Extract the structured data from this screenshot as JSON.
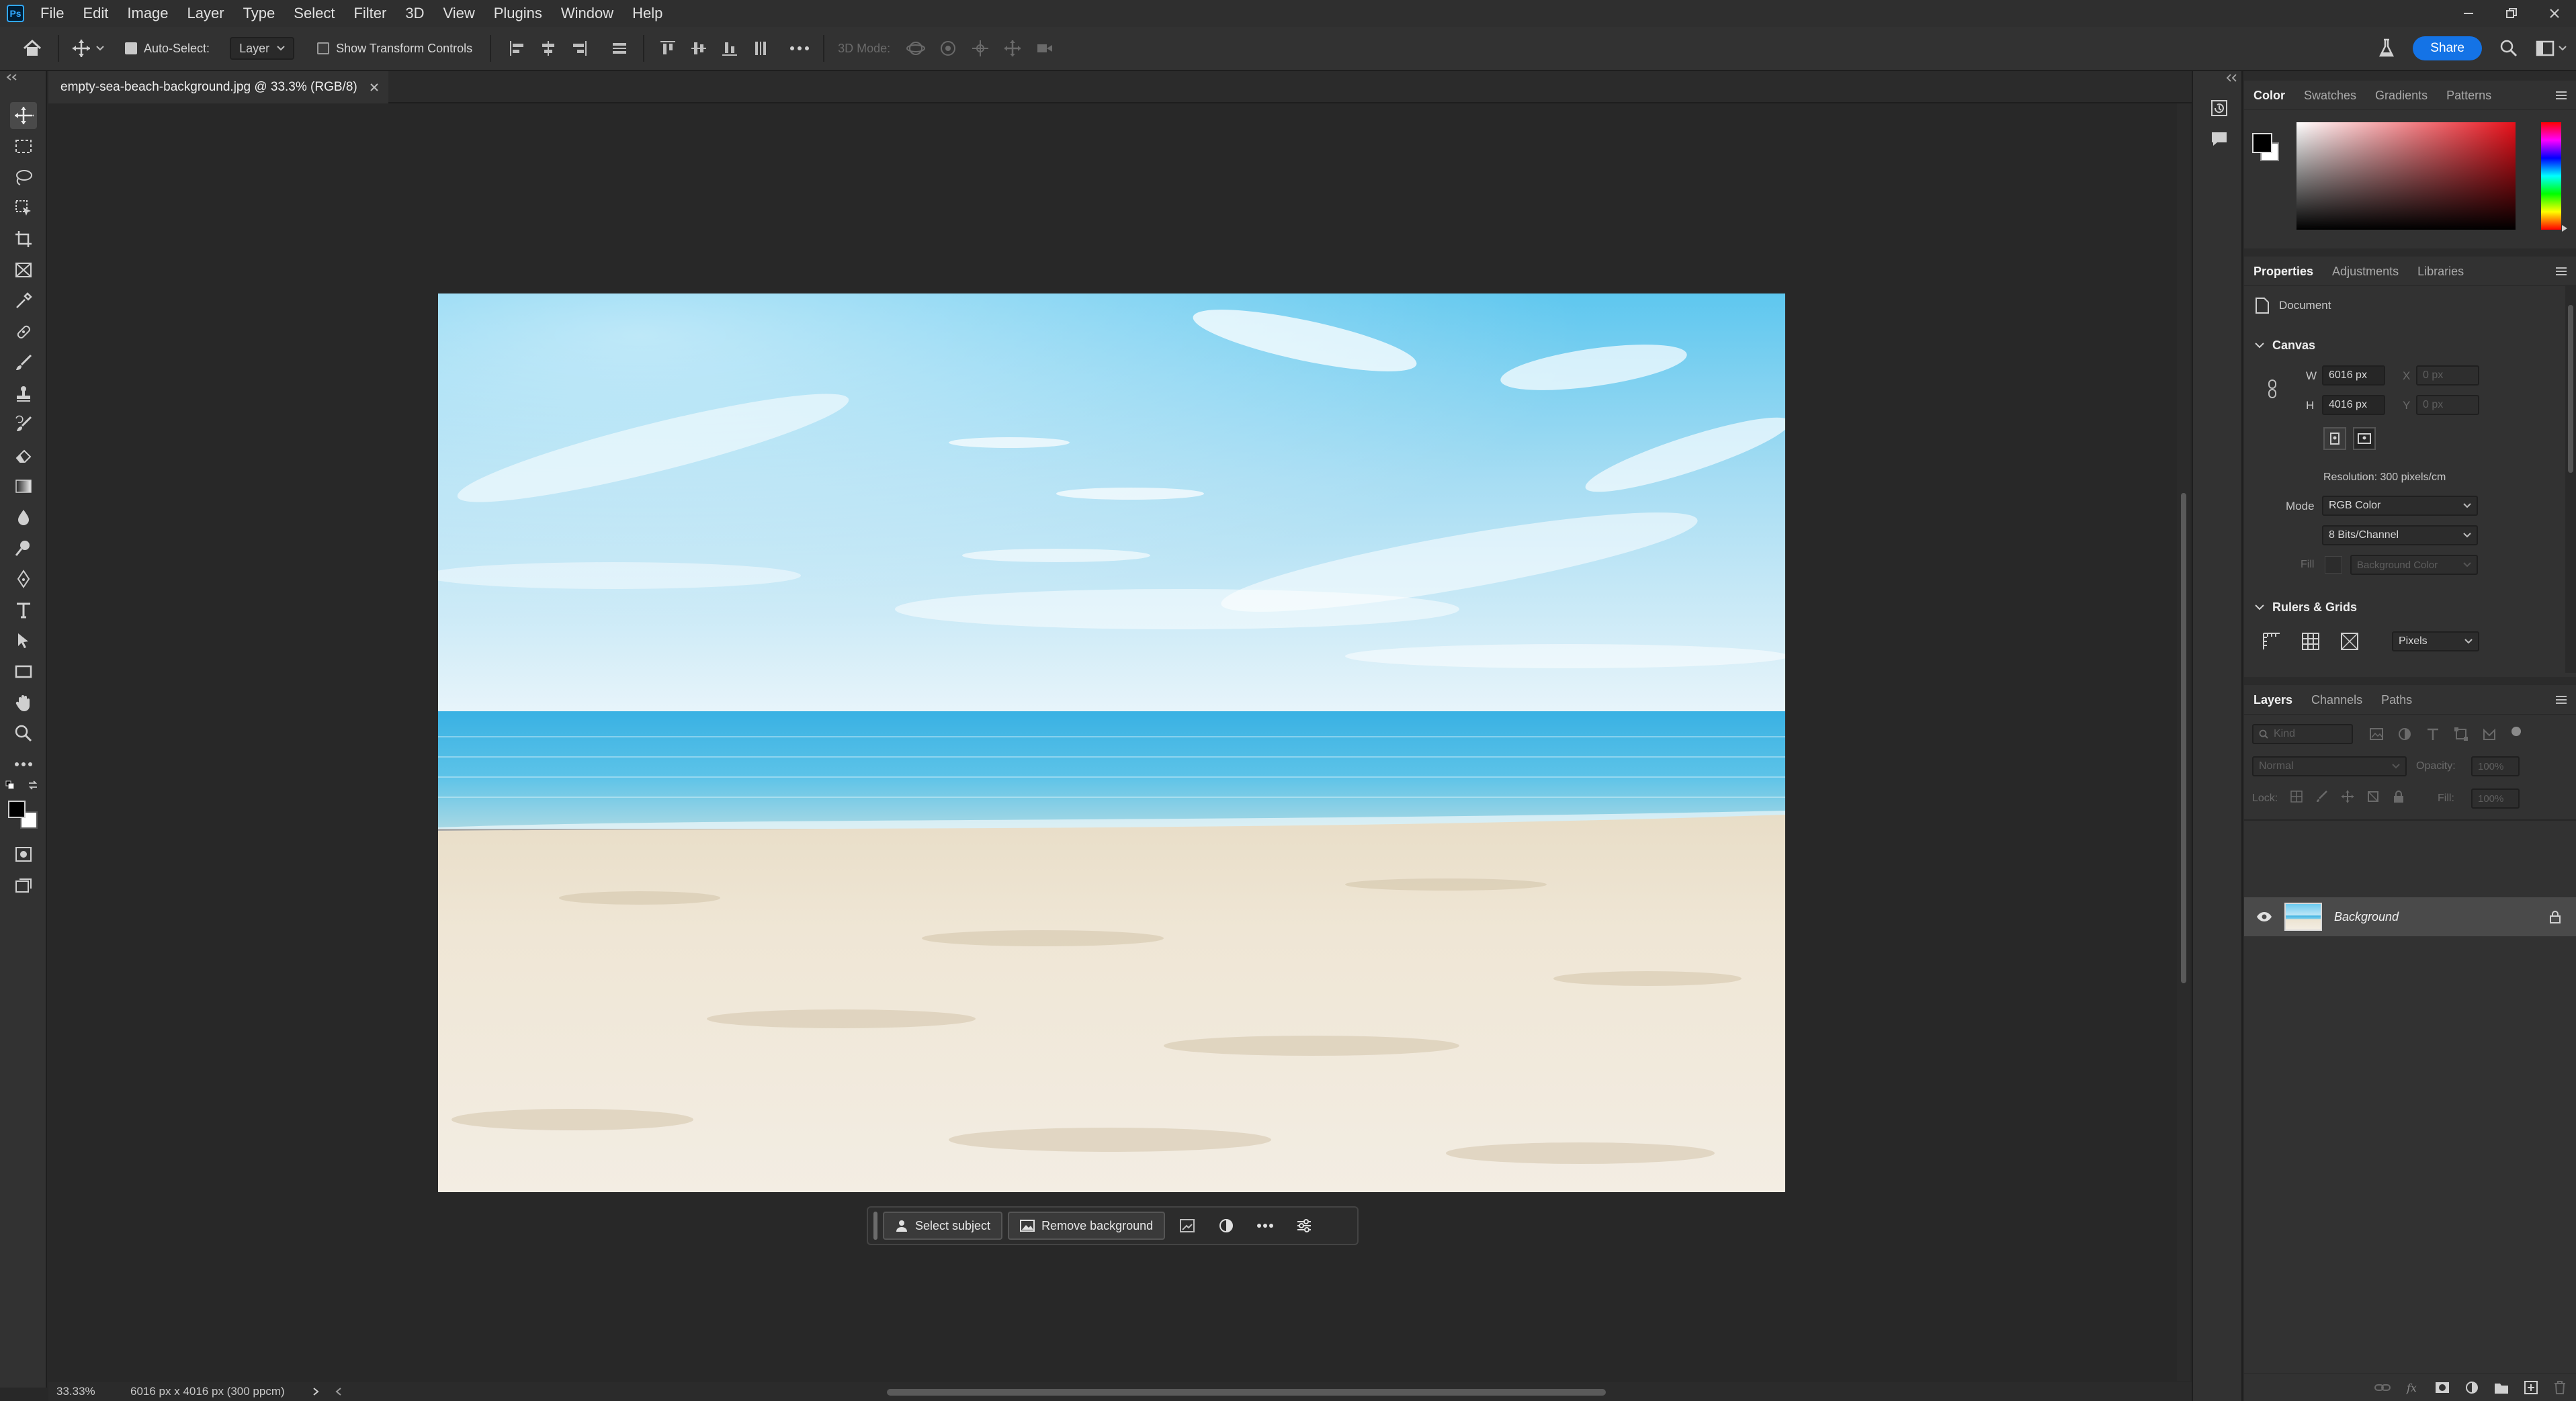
{
  "app": {
    "logo": "Ps"
  },
  "menu": [
    "File",
    "Edit",
    "Image",
    "Layer",
    "Type",
    "Select",
    "Filter",
    "3D",
    "View",
    "Plugins",
    "Window",
    "Help"
  ],
  "options_bar": {
    "auto_select_label": "Auto-Select:",
    "auto_select_value": "Layer",
    "show_transform_label": "Show Transform Controls",
    "mode_3d_label": "3D Mode:",
    "share_label": "Share"
  },
  "document_tab": {
    "title": "empty-sea-beach-background.jpg @ 33.3% (RGB/8)"
  },
  "context_bar": {
    "select_subject": "Select subject",
    "remove_background": "Remove background"
  },
  "status_bar": {
    "zoom": "33.33%",
    "doc_info": "6016 px x 4016 px (300 ppcm)"
  },
  "color_panel": {
    "tabs": [
      "Color",
      "Swatches",
      "Gradients",
      "Patterns"
    ],
    "foreground": "#000000",
    "background": "#ffffff"
  },
  "properties_panel": {
    "tabs": [
      "Properties",
      "Adjustments",
      "Libraries"
    ],
    "doc_label": "Document",
    "canvas_header": "Canvas",
    "w_label": "W",
    "w_value": "6016 px",
    "h_label": "H",
    "h_value": "4016 px",
    "x_label": "X",
    "x_value": "0 px",
    "y_label": "Y",
    "y_value": "0 px",
    "resolution": "Resolution: 300 pixels/cm",
    "mode_label": "Mode",
    "mode_value": "RGB Color",
    "depth_value": "8 Bits/Channel",
    "fill_label": "Fill",
    "fill_value": "Background Color",
    "rulers_header": "Rulers & Grids",
    "units_value": "Pixels"
  },
  "layers_panel": {
    "tabs": [
      "Layers",
      "Channels",
      "Paths"
    ],
    "kind_placeholder": "Kind",
    "blend_mode": "Normal",
    "opacity_label": "Opacity:",
    "opacity_value": "100%",
    "lock_label": "Lock:",
    "fill_label": "Fill:",
    "fill_value": "100%",
    "layers": [
      {
        "name": "Background",
        "visible": true,
        "locked": true
      }
    ]
  }
}
